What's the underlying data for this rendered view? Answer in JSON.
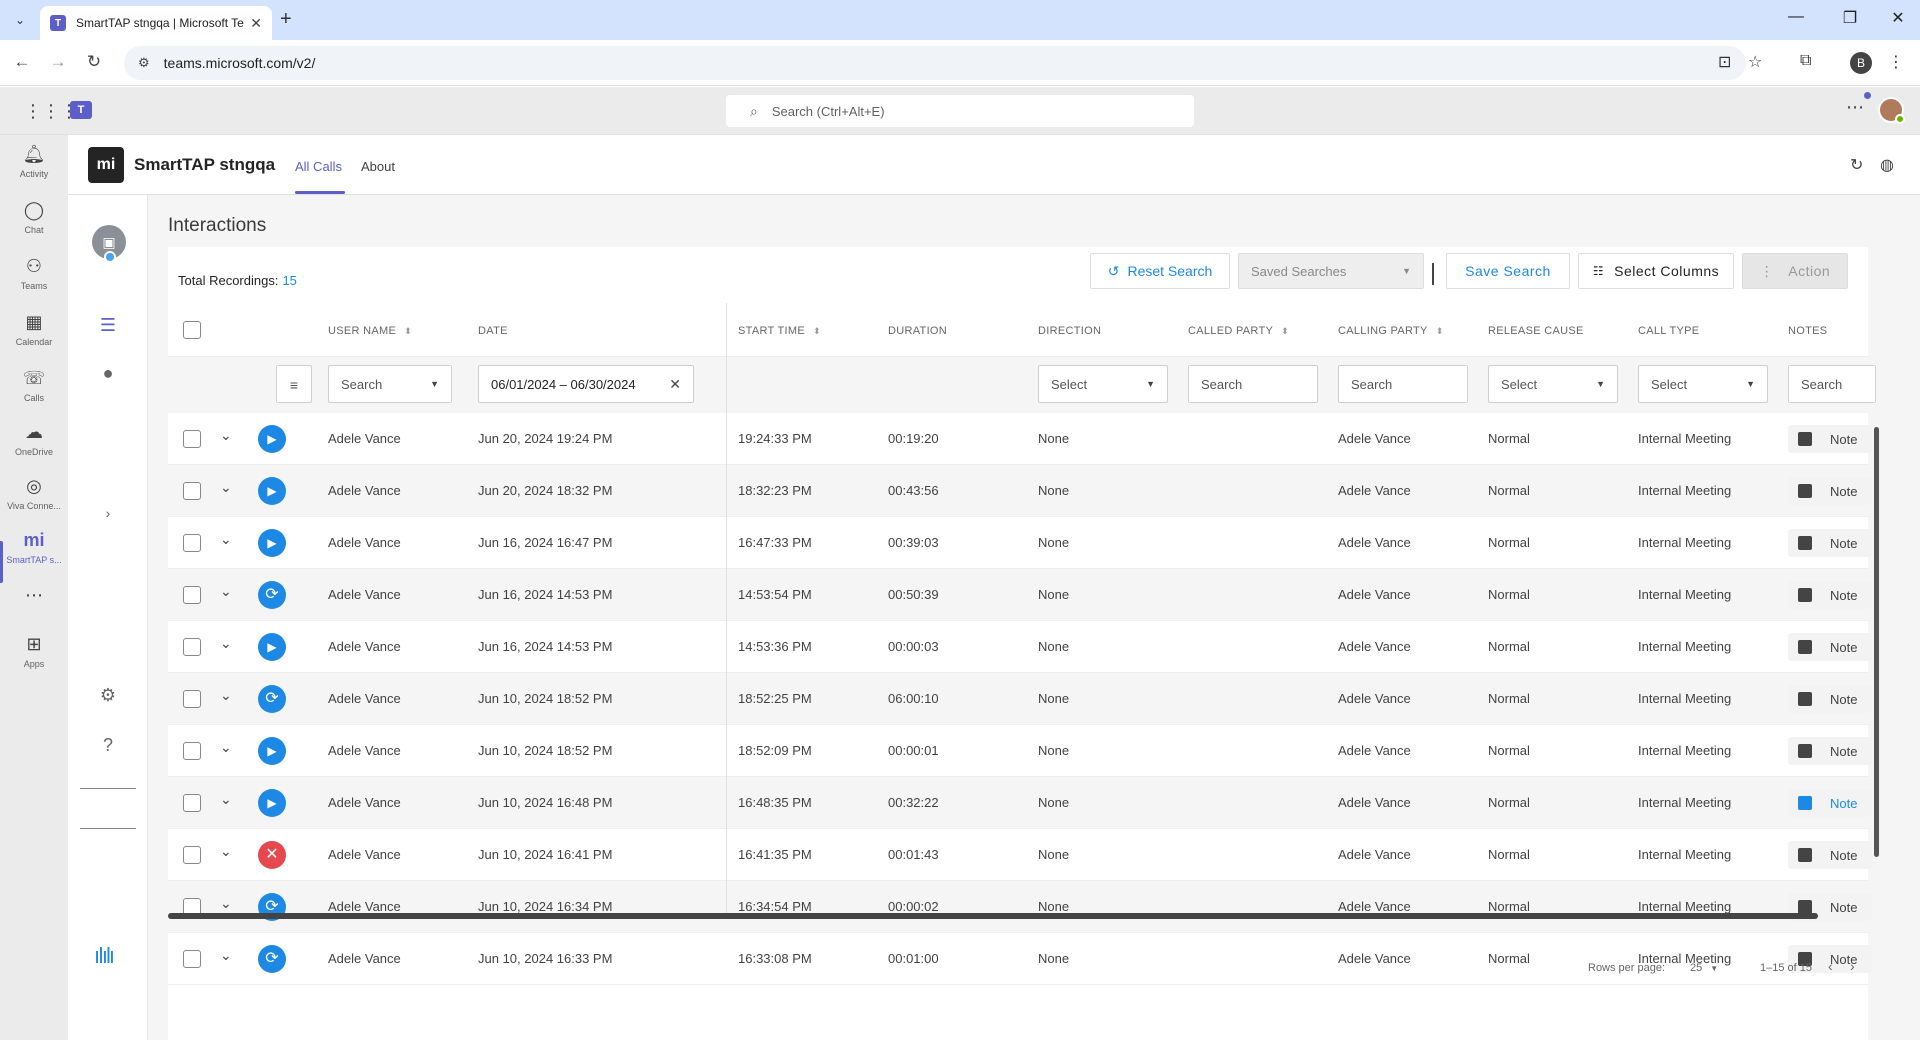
{
  "browser": {
    "tab_title": "SmartTAP stngqa | Microsoft Te",
    "url": "teams.microsoft.com/v2/",
    "profile_initial": "B"
  },
  "teams": {
    "search_placeholder": "Search (Ctrl+Alt+E)",
    "rail": [
      {
        "label": "Activity",
        "icon": "bell-icon"
      },
      {
        "label": "Chat",
        "icon": "chat-icon"
      },
      {
        "label": "Teams",
        "icon": "teams-icon"
      },
      {
        "label": "Calendar",
        "icon": "calendar-icon"
      },
      {
        "label": "Calls",
        "icon": "phone-icon"
      },
      {
        "label": "OneDrive",
        "icon": "cloud-icon"
      },
      {
        "label": "Viva Conne...",
        "icon": "viva-icon"
      },
      {
        "label": "SmartTAP s...",
        "icon": "smarttap-icon"
      },
      {
        "label": "Apps",
        "icon": "plus-square-icon"
      }
    ]
  },
  "app": {
    "name": "SmartTAP stngqa",
    "tabs": [
      "All Calls",
      "About"
    ],
    "page_title": "Interactions",
    "total_label": "Total Recordings:",
    "total_count": "15",
    "buttons": {
      "reset": "Reset Search",
      "saved": "Saved Searches",
      "save": "Save Search",
      "columns": "Select Columns",
      "action": "Action"
    },
    "columns": [
      "USER NAME",
      "DATE",
      "START TIME",
      "DURATION",
      "DIRECTION",
      "CALLED PARTY",
      "CALLING PARTY",
      "RELEASE CAUSE",
      "CALL TYPE",
      "NOTES"
    ],
    "filters": {
      "user": "Search",
      "date": "06/01/2024 – 06/30/2024",
      "direction": "Select",
      "called": "Search",
      "calling": "Search",
      "release": "Select",
      "calltype": "Select",
      "notes": "Search"
    },
    "rows": [
      {
        "status": "play",
        "user": "Adele Vance",
        "date": "Jun 20, 2024 19:24 PM",
        "start": "19:24:33 PM",
        "duration": "00:19:20",
        "direction": "None",
        "calling": "Adele Vance",
        "release": "Normal",
        "calltype": "Internal Meeting",
        "note": "Note"
      },
      {
        "status": "play",
        "user": "Adele Vance",
        "date": "Jun 20, 2024 18:32 PM",
        "start": "18:32:23 PM",
        "duration": "00:43:56",
        "direction": "None",
        "calling": "Adele Vance",
        "release": "Normal",
        "calltype": "Internal Meeting",
        "note": "Note"
      },
      {
        "status": "play",
        "user": "Adele Vance",
        "date": "Jun 16, 2024 16:47 PM",
        "start": "16:47:33 PM",
        "duration": "00:39:03",
        "direction": "None",
        "calling": "Adele Vance",
        "release": "Normal",
        "calltype": "Internal Meeting",
        "note": "Note"
      },
      {
        "status": "sync",
        "user": "Adele Vance",
        "date": "Jun 16, 2024 14:53 PM",
        "start": "14:53:54 PM",
        "duration": "00:50:39",
        "direction": "None",
        "calling": "Adele Vance",
        "release": "Normal",
        "calltype": "Internal Meeting",
        "note": "Note"
      },
      {
        "status": "play",
        "user": "Adele Vance",
        "date": "Jun 16, 2024 14:53 PM",
        "start": "14:53:36 PM",
        "duration": "00:00:03",
        "direction": "None",
        "calling": "Adele Vance",
        "release": "Normal",
        "calltype": "Internal Meeting",
        "note": "Note"
      },
      {
        "status": "sync",
        "user": "Adele Vance",
        "date": "Jun 10, 2024 18:52 PM",
        "start": "18:52:25 PM",
        "duration": "06:00:10",
        "direction": "None",
        "calling": "Adele Vance",
        "release": "Normal",
        "calltype": "Internal Meeting",
        "note": "Note"
      },
      {
        "status": "play",
        "user": "Adele Vance",
        "date": "Jun 10, 2024 18:52 PM",
        "start": "18:52:09 PM",
        "duration": "00:00:01",
        "direction": "None",
        "calling": "Adele Vance",
        "release": "Normal",
        "calltype": "Internal Meeting",
        "note": "Note"
      },
      {
        "status": "play",
        "user": "Adele Vance",
        "date": "Jun 10, 2024 16:48 PM",
        "start": "16:48:35 PM",
        "duration": "00:32:22",
        "direction": "None",
        "calling": "Adele Vance",
        "release": "Normal",
        "calltype": "Internal Meeting",
        "note": "Note",
        "note_active": true
      },
      {
        "status": "err",
        "user": "Adele Vance",
        "date": "Jun 10, 2024 16:41 PM",
        "start": "16:41:35 PM",
        "duration": "00:01:43",
        "direction": "None",
        "calling": "Adele Vance",
        "release": "Normal",
        "calltype": "Internal Meeting",
        "note": "Note"
      },
      {
        "status": "sync",
        "user": "Adele Vance",
        "date": "Jun 10, 2024 16:34 PM",
        "start": "16:34:54 PM",
        "duration": "00:00:02",
        "direction": "None",
        "calling": "Adele Vance",
        "release": "Normal",
        "calltype": "Internal Meeting",
        "note": "Note"
      },
      {
        "status": "sync",
        "user": "Adele Vance",
        "date": "Jun 10, 2024 16:33 PM",
        "start": "16:33:08 PM",
        "duration": "00:01:00",
        "direction": "None",
        "calling": "Adele Vance",
        "release": "Normal",
        "calltype": "Internal Meeting",
        "note": "Note"
      }
    ],
    "footer": {
      "rows_per_page_label": "Rows per page:",
      "rows_per_page": "25",
      "range": "1–15 of 15"
    }
  },
  "colors": {
    "accent": "#5b5fc7",
    "link": "#1e88e5",
    "error": "#e5484d"
  }
}
